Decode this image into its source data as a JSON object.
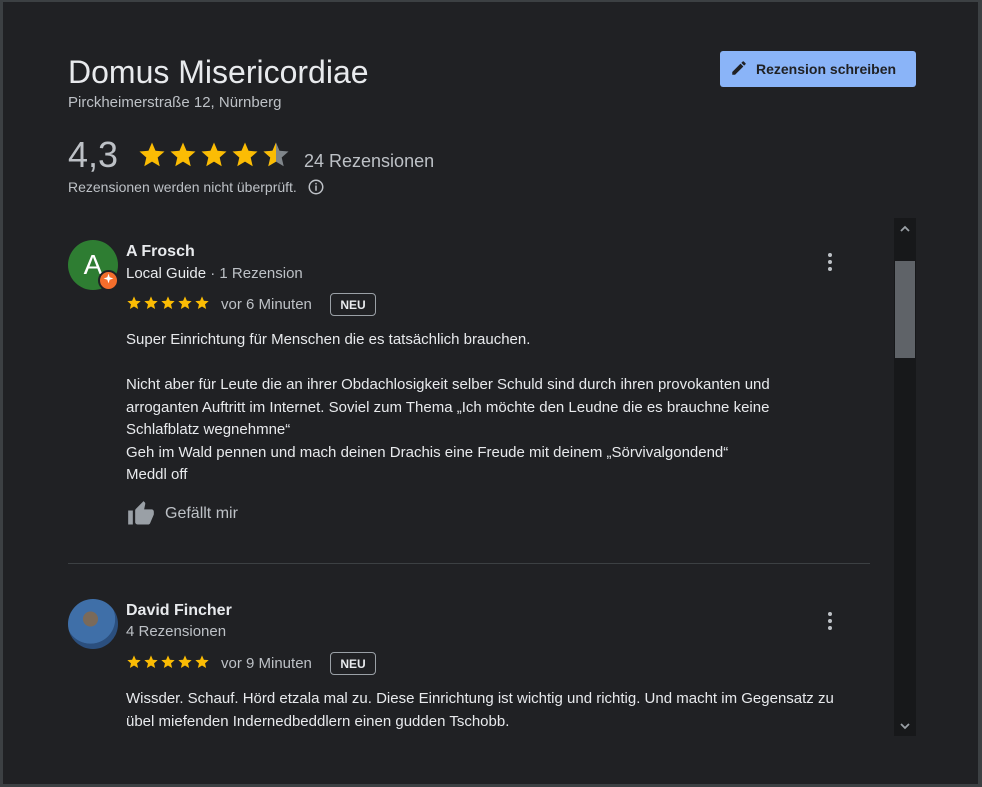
{
  "place": {
    "name": "Domus Misericordiae",
    "address": "Pirckheimerstraße 12, Nürnberg",
    "rating": "4,3",
    "rating_value": 4.3,
    "review_count": "24 Rezensionen",
    "unverified_note": "Rezensionen werden nicht überprüft."
  },
  "write_review_label": "Rezension schreiben",
  "reviews": [
    {
      "author": "A Frosch",
      "avatar_letter": "A",
      "local_guide": "Local Guide",
      "meta": " · 1 Rezension",
      "stars": 5,
      "time": "vor 6 Minuten",
      "badge": "NEU",
      "text": [
        "Super Einrichtung für Menschen die es tatsächlich brauchen.",
        "",
        "Nicht aber für Leute die an ihrer Obdachlosigkeit selber Schuld sind durch ihren provokanten und arroganten Auftritt im Internet. Soviel zum Thema „Ich möchte den Leudne die es brauchne keine Schlafblatz wegnehmne“",
        "Geh im Wald pennen und mach deinen Drachis eine Freude mit deinem „Sörvivalgondend“",
        "Meddl off"
      ],
      "like_label": "Gefällt mir"
    },
    {
      "author": "David Fincher",
      "meta": "4 Rezensionen",
      "stars": 5,
      "time": "vor 9 Minuten",
      "badge": "NEU",
      "text": [
        "Wissder. Schauf. Hörd etzala mal zu. Diese Einrichtung ist wichtig und richtig. Und macht im Gegensatz zu übel miefenden Indernedbeddlern einen gudden Tschobb."
      ]
    }
  ],
  "colors": {
    "star": "#fbbc04",
    "accent": "#8ab4f8",
    "background": "#202124"
  },
  "icons": [
    "pencil-icon",
    "star-icon",
    "info-icon",
    "thumbs-up-icon",
    "more-vert-icon",
    "chevron-up-icon",
    "chevron-down-icon"
  ]
}
